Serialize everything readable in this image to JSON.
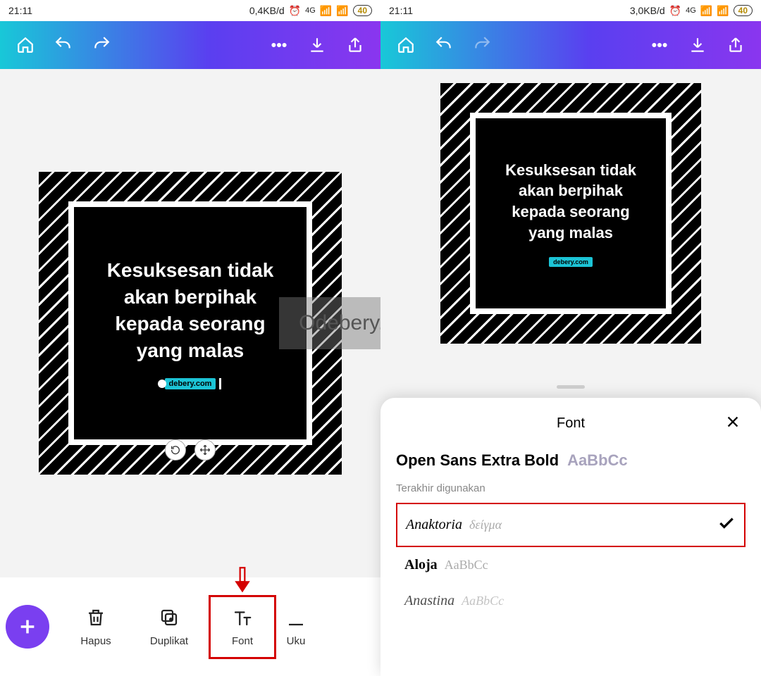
{
  "left": {
    "status": {
      "time": "21:11",
      "net": "0,4KB/d",
      "battery": "40"
    },
    "quote_line1": "Kesuksesan tidak",
    "quote_line2": "akan berpihak",
    "quote_line3": "kepada seorang",
    "quote_line4": "yang malas",
    "chip": "debery.com",
    "watermark": "Odebery.com",
    "tools": {
      "hapus": "Hapus",
      "duplikat": "Duplikat",
      "font": "Font",
      "uku": "Uku"
    }
  },
  "right": {
    "status": {
      "time": "21:11",
      "net": "3,0KB/d",
      "battery": "40"
    },
    "quote_line1": "Kesuksesan tidak",
    "quote_line2": "akan berpihak",
    "quote_line3": "kepada seorang",
    "quote_line4": "yang malas",
    "sheet": {
      "title": "Font",
      "current_name": "Open Sans Extra Bold",
      "current_sample": "AaBbCc",
      "section": "Terakhir digunakan",
      "rows": [
        {
          "name": "Anaktoria",
          "sample": "δείγμα",
          "checked": true
        },
        {
          "name": "Aloja",
          "sample": "AaBbCc",
          "checked": false
        },
        {
          "name": "Anastina",
          "sample": "AaBbCc",
          "checked": false
        }
      ]
    }
  }
}
